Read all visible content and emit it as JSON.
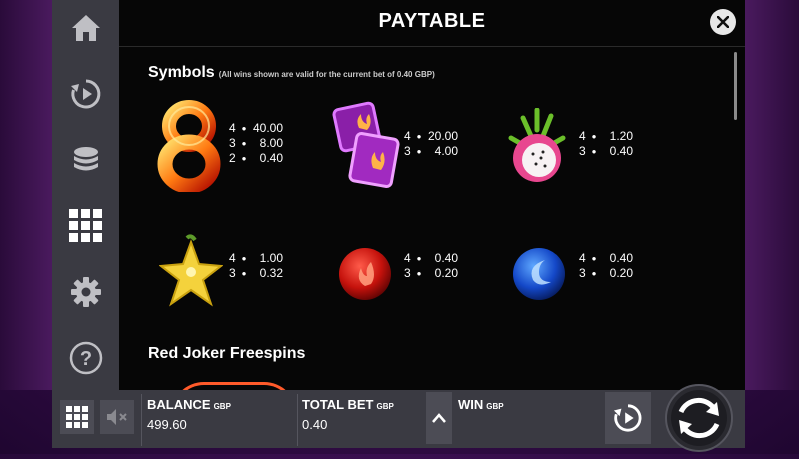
{
  "title": "PAYTABLE",
  "sidebar": {
    "items": [
      {
        "icon": "home-icon"
      },
      {
        "icon": "autoplay-icon"
      },
      {
        "icon": "coins-icon"
      },
      {
        "icon": "paytable-grid-icon"
      },
      {
        "icon": "settings-icon"
      },
      {
        "icon": "help-icon"
      }
    ]
  },
  "symbols_section": {
    "title": "Symbols",
    "note": "(All wins shown are valid for the current bet of 0.40 GBP)",
    "symbols": [
      {
        "icon": "red-eight-icon",
        "pays": [
          {
            "count": "4",
            "amount": "40.00"
          },
          {
            "count": "3",
            "amount": "8.00"
          },
          {
            "count": "2",
            "amount": "0.40"
          }
        ]
      },
      {
        "icon": "purple-dice-icon",
        "pays": [
          {
            "count": "4",
            "amount": "20.00"
          },
          {
            "count": "3",
            "amount": "4.00"
          }
        ]
      },
      {
        "icon": "dragon-fruit-icon",
        "pays": [
          {
            "count": "4",
            "amount": "1.20"
          },
          {
            "count": "3",
            "amount": "0.40"
          }
        ]
      },
      {
        "icon": "star-fruit-icon",
        "pays": [
          {
            "count": "4",
            "amount": "1.00"
          },
          {
            "count": "3",
            "amount": "0.32"
          }
        ]
      },
      {
        "icon": "red-orb-icon",
        "pays": [
          {
            "count": "4",
            "amount": "0.40"
          },
          {
            "count": "3",
            "amount": "0.20"
          }
        ]
      },
      {
        "icon": "blue-orb-icon",
        "pays": [
          {
            "count": "4",
            "amount": "0.40"
          },
          {
            "count": "3",
            "amount": "0.20"
          }
        ]
      }
    ]
  },
  "freespins_section": {
    "title": "Red Joker Freespins"
  },
  "bottom": {
    "balance_label": "BALANCE",
    "balance_currency": "GBP",
    "balance_value": "499.60",
    "bet_label": "TOTAL BET",
    "bet_currency": "GBP",
    "bet_value": "0.40",
    "win_label": "WIN",
    "win_currency": "GBP",
    "win_value": ""
  },
  "colors": {
    "accent": "#ffffff",
    "panel": "#060606",
    "bar": "#3a3a42"
  }
}
